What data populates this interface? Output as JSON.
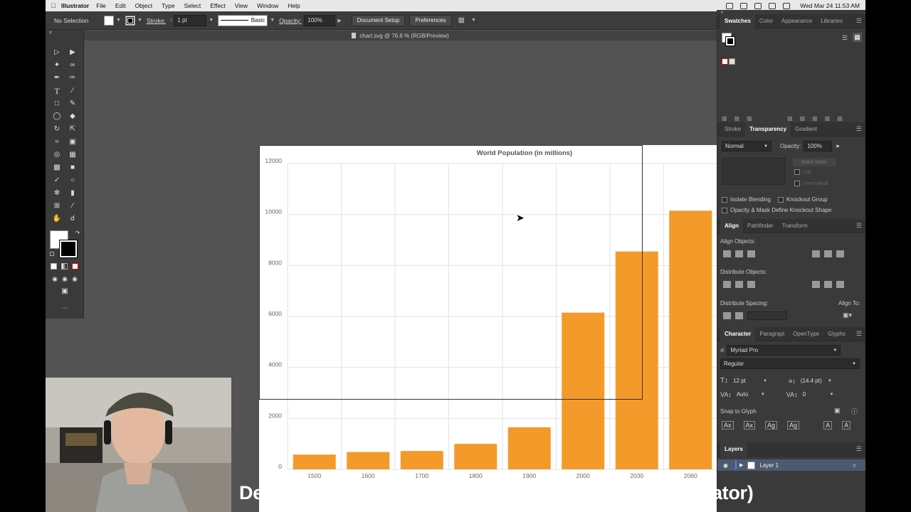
{
  "menubar": {
    "app_name": "Illustrator",
    "items": [
      "File",
      "Edit",
      "Object",
      "Type",
      "Select",
      "Effect",
      "View",
      "Window",
      "Help"
    ],
    "clock": "Wed Mar 24  11:53 AM"
  },
  "controlbar": {
    "selection": "No Selection",
    "stroke_label": "Stroke:",
    "stroke_value": "1 pt",
    "stroke_style": "Basic",
    "opacity_label": "Opacity:",
    "opacity_value": "100%",
    "document_setup": "Document Setup",
    "preferences": "Preferences"
  },
  "document": {
    "tab_title": "chart.svg @ 76.6 % (RGB/Preview)"
  },
  "chart_data": {
    "type": "bar",
    "title": "World Population (in millions)",
    "categories": [
      "1500",
      "1600",
      "1700",
      "1800",
      "1900",
      "2000",
      "2030",
      "2060"
    ],
    "values": [
      580,
      680,
      720,
      1000,
      1650,
      6150,
      8550,
      10150
    ],
    "ylim": [
      0,
      12000
    ],
    "yticks": [
      "0",
      "2000",
      "4000",
      "6000",
      "8000",
      "10000",
      "12000"
    ],
    "bar_color": "#f39a2b",
    "grid": true
  },
  "panels": {
    "swatches_tabs": [
      "Swatches",
      "Color",
      "Appearance",
      "Libraries"
    ],
    "transparency_tabs": [
      "Stroke",
      "Transparency",
      "Gradient"
    ],
    "blend_mode": "Normal",
    "opacity_label": "Opacity:",
    "opacity_value": "100%",
    "make_mask": "Make Mask",
    "clip": "Clip",
    "invert_mask": "Invert Mask",
    "isolate_blending": "Isolate Blending",
    "knockout_group": "Knockout Group",
    "opacity_mask": "Opacity & Mask Define Knockout Shape",
    "align_tabs": [
      "Align",
      "Pathfinder",
      "Transform"
    ],
    "align_objects": "Align Objects:",
    "distribute_objects": "Distribute Objects:",
    "distribute_spacing": "Distribute Spacing:",
    "align_to": "Align To:",
    "character_tabs": [
      "Character",
      "Paragrapl",
      "OpenType",
      "Glyphs"
    ],
    "font_family": "Myriad Pro",
    "font_style": "Regular",
    "font_size": "12 pt",
    "leading": "(14.4 pt)",
    "kerning": "Auto",
    "tracking": "0",
    "snap_to_glyph": "Snap to Glyph",
    "layers_title": "Layers",
    "layer_name": "Layer 1"
  },
  "caption": "Designing with Data: PNG and SVG Export (for Illustrator)"
}
